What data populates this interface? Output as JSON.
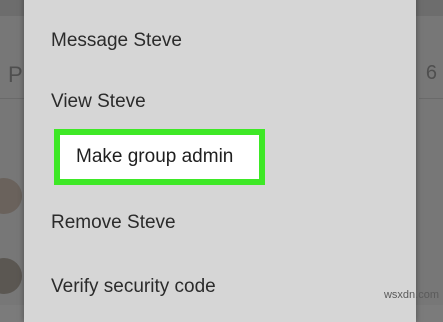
{
  "background": {
    "left_letter": "P",
    "right_number": "6"
  },
  "menu": {
    "items": [
      {
        "label": "Message Steve"
      },
      {
        "label": "View Steve"
      },
      {
        "label": "Make group admin"
      },
      {
        "label": "Remove Steve"
      },
      {
        "label": "Verify security code"
      }
    ],
    "highlight_color": "#3ee826",
    "background_color": "#d6d6d6"
  },
  "watermark": "wsxdn.com"
}
